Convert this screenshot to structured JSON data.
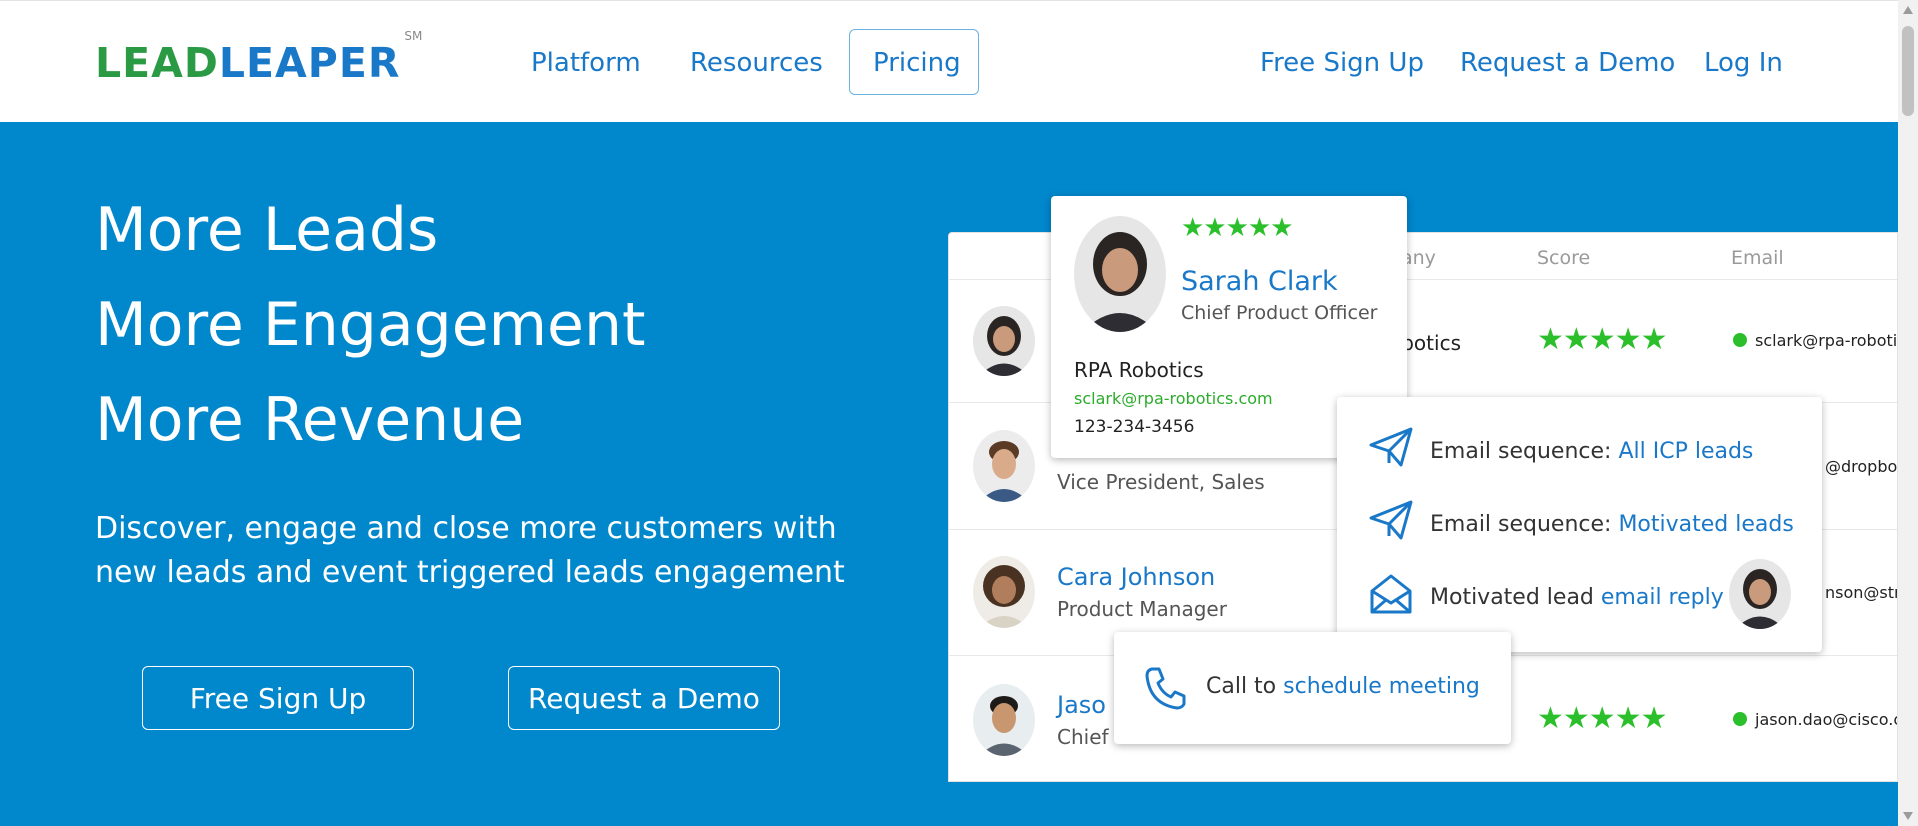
{
  "header": {
    "logo": {
      "part1": "LEAD",
      "part2": "LEAPER",
      "mark": "SM"
    },
    "nav": {
      "platform": "Platform",
      "resources": "Resources",
      "pricing": "Pricing"
    },
    "actions": {
      "signup": "Free Sign Up",
      "demo": "Request a Demo",
      "login": "Log In"
    }
  },
  "hero": {
    "lines": [
      "More Leads",
      "More Engagement",
      "More Revenue"
    ],
    "subtitle": "Discover, engage and close more customers with new leads and event triggered leads engagement",
    "signup_button": "Free Sign Up",
    "demo_button": "Request a Demo"
  },
  "table": {
    "headers": {
      "company": "any",
      "score": "Score",
      "email": "Email"
    },
    "rows": [
      {
        "company": "obotics",
        "email": "sclark@rpa-roboti"
      },
      {
        "title": "Vice President, Sales",
        "email": "@dropbo"
      },
      {
        "name": "Cara Johnson",
        "title": "Product Manager",
        "email": "nson@stri"
      },
      {
        "name": "Jaso",
        "title": "Chief",
        "email": "jason.dao@cisco.c"
      }
    ]
  },
  "profile_card": {
    "name": "Sarah Clark",
    "title": "Chief Product Officer",
    "company": "RPA Robotics",
    "email": "sclark@rpa-robotics.com",
    "phone": "123-234-3456",
    "rating": 5
  },
  "sequence_card": {
    "items": [
      {
        "prefix": "Email sequence: ",
        "link": "All ICP leads",
        "icon": "paper-plane-icon"
      },
      {
        "prefix": "Email sequence: ",
        "link": "Motivated leads",
        "icon": "paper-plane-icon"
      },
      {
        "prefix": "Motivated lead ",
        "link": "email reply",
        "icon": "open-envelope-icon"
      }
    ]
  },
  "call_card": {
    "prefix": "Call to ",
    "link": "schedule meeting",
    "icon": "phone-icon"
  },
  "colors": {
    "brand_blue": "#0087cc",
    "link_blue": "#1a78c9",
    "logo_green": "#2b9a44",
    "star_green": "#2cbf2c"
  }
}
